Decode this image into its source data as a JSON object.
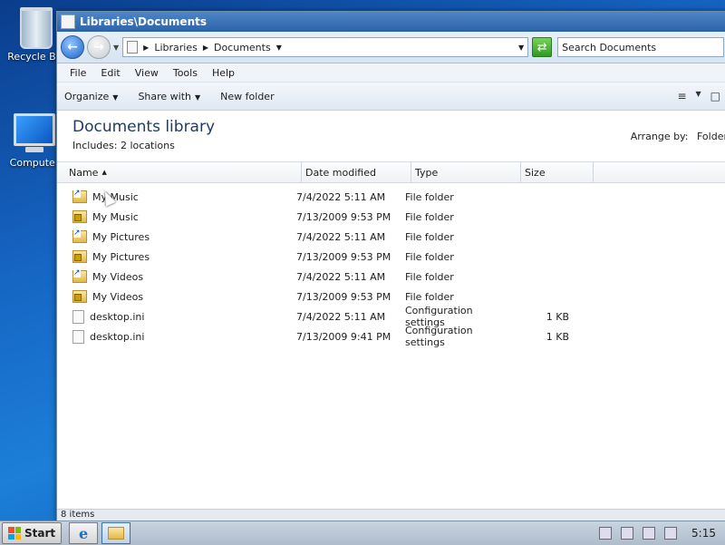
{
  "desktop": {
    "icons": [
      {
        "label": "Recycle Bin",
        "icon": "recycle-bin-icon"
      },
      {
        "label": "Computer",
        "icon": "computer-icon"
      }
    ]
  },
  "window": {
    "title": "Libraries\\Documents",
    "address": {
      "crumb1": "Libraries",
      "crumb2": "Documents"
    },
    "search_placeholder": "Search Documents",
    "menu": [
      "File",
      "Edit",
      "View",
      "Tools",
      "Help"
    ],
    "commands": {
      "organize": "Organize",
      "share": "Share with",
      "newfolder": "New folder"
    },
    "library": {
      "title": "Documents library",
      "includes_label": "Includes:",
      "includes_link": "2 locations",
      "arrange_label": "Arrange by:",
      "arrange_value": "Folder"
    },
    "columns": {
      "name": "Name",
      "date": "Date modified",
      "type": "Type",
      "size": "Size"
    },
    "files": [
      {
        "name": "My Music",
        "date": "7/4/2022 5:11 AM",
        "type": "File folder",
        "size": "",
        "icon": "link"
      },
      {
        "name": "My Music",
        "date": "7/13/2009 9:53 PM",
        "type": "File folder",
        "size": "",
        "icon": "lock"
      },
      {
        "name": "My Pictures",
        "date": "7/4/2022 5:11 AM",
        "type": "File folder",
        "size": "",
        "icon": "link"
      },
      {
        "name": "My Pictures",
        "date": "7/13/2009 9:53 PM",
        "type": "File folder",
        "size": "",
        "icon": "lock"
      },
      {
        "name": "My Videos",
        "date": "7/4/2022 5:11 AM",
        "type": "File folder",
        "size": "",
        "icon": "link"
      },
      {
        "name": "My Videos",
        "date": "7/13/2009 9:53 PM",
        "type": "File folder",
        "size": "",
        "icon": "lock"
      },
      {
        "name": "desktop.ini",
        "date": "7/4/2022 5:11 AM",
        "type": "Configuration settings",
        "size": "1 KB",
        "icon": "ini"
      },
      {
        "name": "desktop.ini",
        "date": "7/13/2009 9:41 PM",
        "type": "Configuration settings",
        "size": "1 KB",
        "icon": "ini"
      }
    ],
    "status": "8 items"
  },
  "taskbar": {
    "start": "Start",
    "clock": "5:15"
  }
}
